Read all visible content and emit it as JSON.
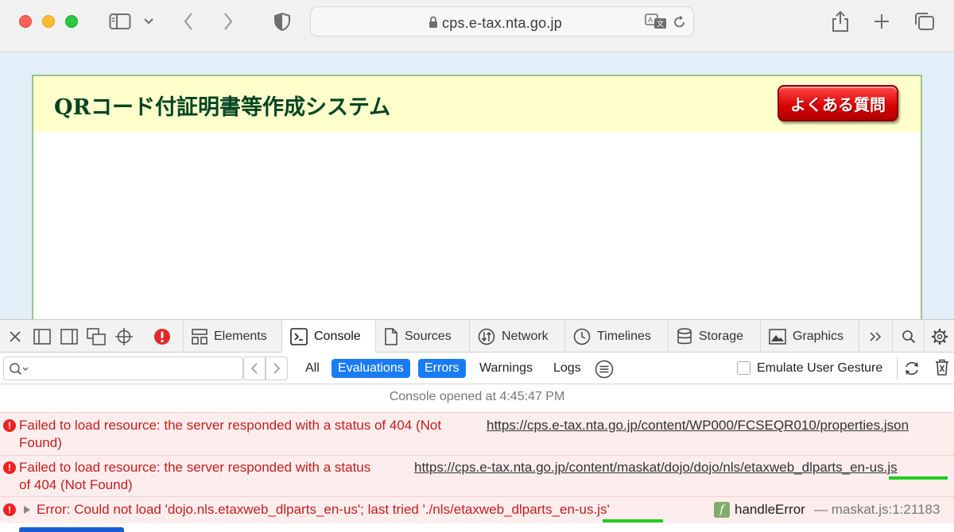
{
  "browser": {
    "url": "cps.e-tax.nta.go.jp"
  },
  "page": {
    "title": "QRコード付証明書等作成システム",
    "faq_button": "よくある質問"
  },
  "inspector": {
    "tabs": [
      "Elements",
      "Console",
      "Sources",
      "Network",
      "Timelines",
      "Storage",
      "Graphics"
    ],
    "active_tab": "Console",
    "filters": {
      "all": "All",
      "evaluations": "Evaluations",
      "errors": "Errors",
      "warnings": "Warnings",
      "logs": "Logs",
      "emulate": "Emulate User Gesture"
    },
    "console": {
      "opened": "Console opened at 4:45:47 PM",
      "messages": [
        {
          "text_line1": "Failed to load resource: the server responded with a status of 404 (Not",
          "text_line2": "Found)",
          "url": "https://cps.e-tax.nta.go.jp/content/WP000/FCSEQR010/properties.json"
        },
        {
          "text_line1": "Failed to load resource: the server responded with a status",
          "text_line2": "of 404 (Not Found)",
          "url": "https://cps.e-tax.nta.go.jp/content/maskat/dojo/dojo/nls/etaxweb_dlparts_en-us.js"
        },
        {
          "text": "Error: Could not load 'dojo.nls.etaxweb_dlparts_en-us'; last tried './nls/etaxweb_dlparts_en-us.js'",
          "function": "handleError",
          "source": "— maskat.js:1:21183"
        }
      ]
    }
  },
  "colors": {
    "error_text": "#c41d1d",
    "error_bg": "#fdeded",
    "accent": "#1a7cf4",
    "title_green": "#004422"
  }
}
